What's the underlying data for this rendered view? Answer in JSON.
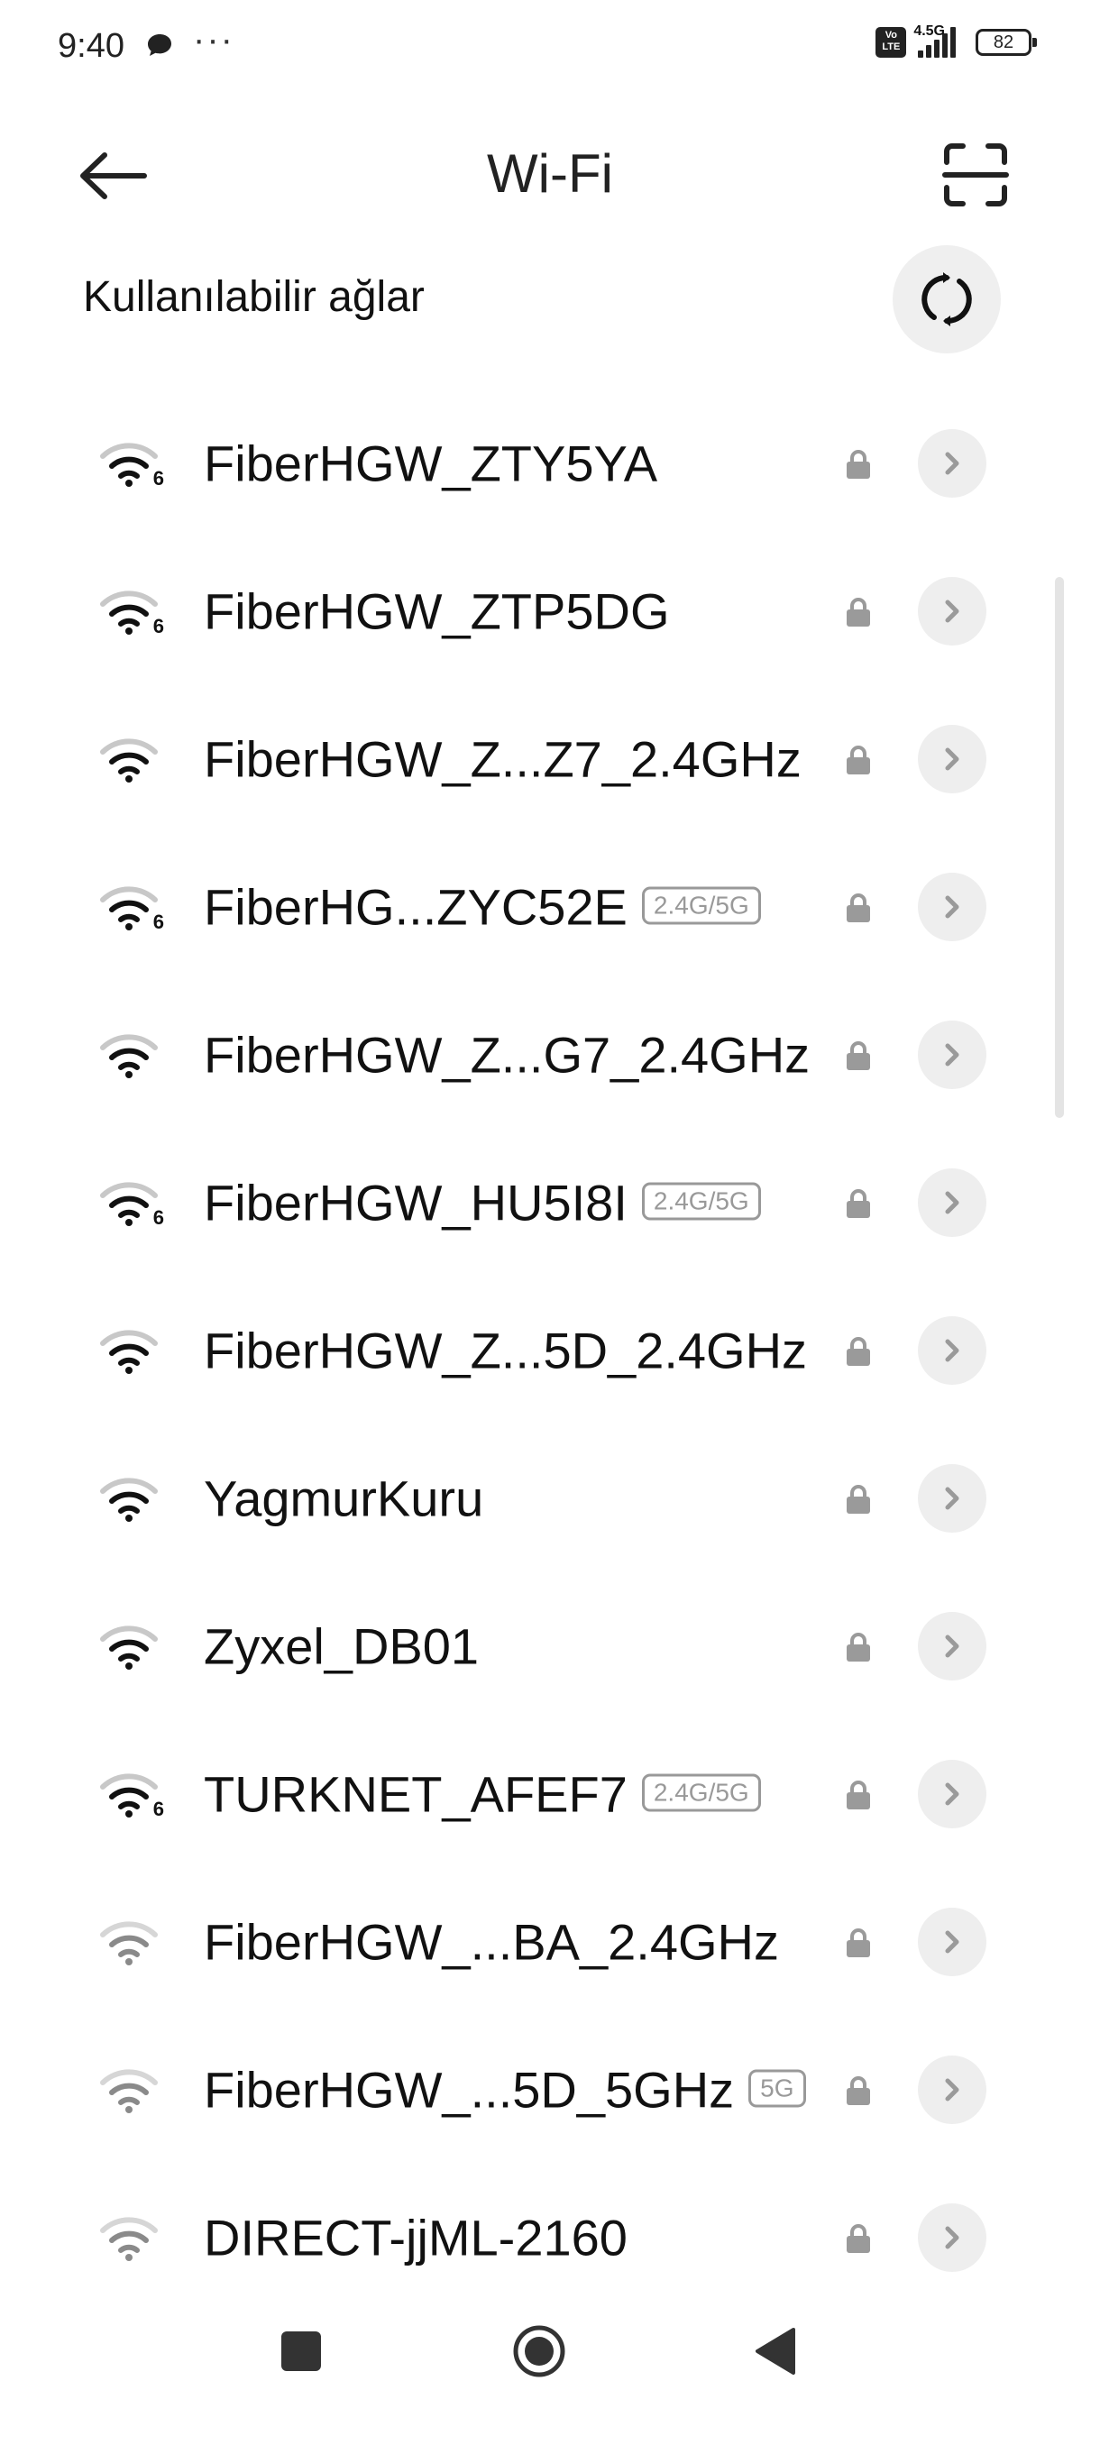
{
  "status_bar": {
    "time": "9:40",
    "volte": "Vo\nLTE",
    "network": "4.5G",
    "battery": "82",
    "icons": [
      "message-icon",
      "more-dots-icon",
      "volte-icon",
      "signal-icon",
      "battery-icon"
    ]
  },
  "header": {
    "title": "Wi-Fi",
    "back_icon": "arrow-left-icon",
    "scan_icon": "scan-qr-icon"
  },
  "section": {
    "title": "Kullanılabilir ağlar",
    "refresh_icon": "refresh-icon"
  },
  "networks": [
    {
      "ssid": "FiberHGW_ZTY5YA",
      "band": "",
      "wifi6": true
    },
    {
      "ssid": "FiberHGW_ZTP5DG",
      "band": "",
      "wifi6": true
    },
    {
      "ssid": "FiberHGW_Z...Z7_2.4GHz",
      "band": "",
      "wifi6": false
    },
    {
      "ssid": "FiberHG...ZYC52E",
      "band": "2.4G/5G",
      "wifi6": true
    },
    {
      "ssid": "FiberHGW_Z...G7_2.4GHz",
      "band": "",
      "wifi6": false
    },
    {
      "ssid": "FiberHGW_HU5I8I",
      "band": "2.4G/5G",
      "wifi6": true
    },
    {
      "ssid": "FiberHGW_Z...5D_2.4GHz",
      "band": "",
      "wifi6": false
    },
    {
      "ssid": "YagmurKuru",
      "band": "",
      "wifi6": false
    },
    {
      "ssid": "Zyxel_DB01",
      "band": "",
      "wifi6": false
    },
    {
      "ssid": "TURKNET_AFEF7",
      "band": "2.4G/5G",
      "wifi6": true
    },
    {
      "ssid": "FiberHGW_...BA_2.4GHz",
      "band": "",
      "wifi6": false
    },
    {
      "ssid": "FiberHGW_...5D_5GHz",
      "band": "5G",
      "wifi6": false
    },
    {
      "ssid": "DIRECT-jjML-2160",
      "band": "",
      "wifi6": false
    }
  ],
  "wifi6_label": "6",
  "nav_bar": {
    "icons": [
      "recents-square-icon",
      "home-circle-icon",
      "back-triangle-icon"
    ]
  },
  "colors": {
    "background": "#ffffff",
    "text": "#111111",
    "muted": "#999999",
    "button_bg": "#eeeeee"
  }
}
